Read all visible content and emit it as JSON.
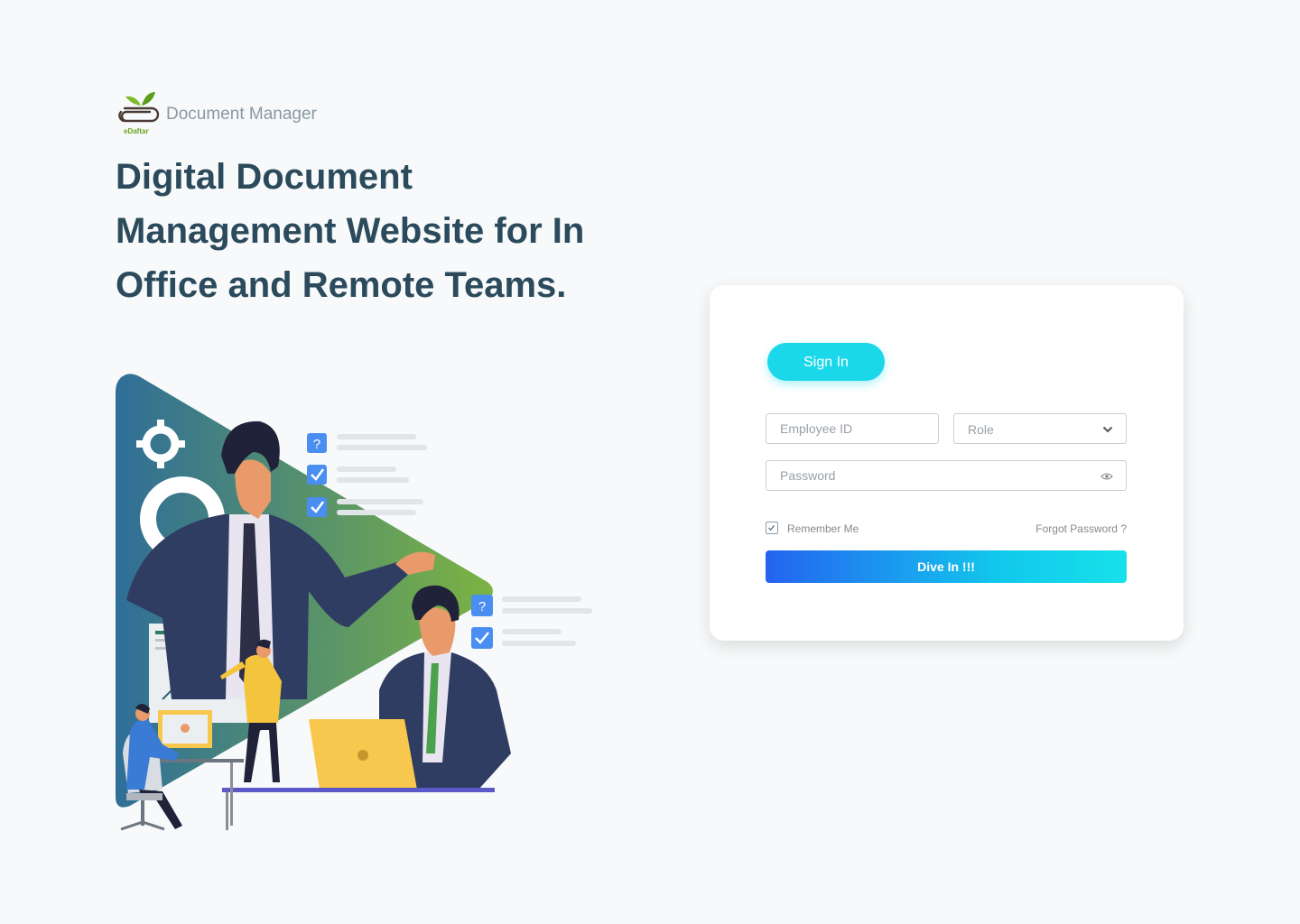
{
  "brand": {
    "name": "Document Manager",
    "logo_text": "eDaftar",
    "logo_icon": "paperclip-leaf-icon",
    "accent_color": "#6aa31b"
  },
  "hero": {
    "headline": "Digital Document Management Website for In Office and Remote Teams."
  },
  "login": {
    "tab_label": "Sign In",
    "employee_id": {
      "placeholder": "Employee ID",
      "value": ""
    },
    "role": {
      "placeholder": "Role",
      "icon": "chevron-down-icon"
    },
    "password": {
      "placeholder": "Password",
      "value": "",
      "icon": "eye-icon"
    },
    "remember": {
      "label": "Remember Me",
      "checked": true
    },
    "forgot_label": "Forgot Password ?",
    "submit_label": "Dive In !!!",
    "colors": {
      "tab": "#1ad8ea",
      "button_start": "#2563f0",
      "button_end": "#16e1ea",
      "headline": "#2b4a5c"
    }
  }
}
